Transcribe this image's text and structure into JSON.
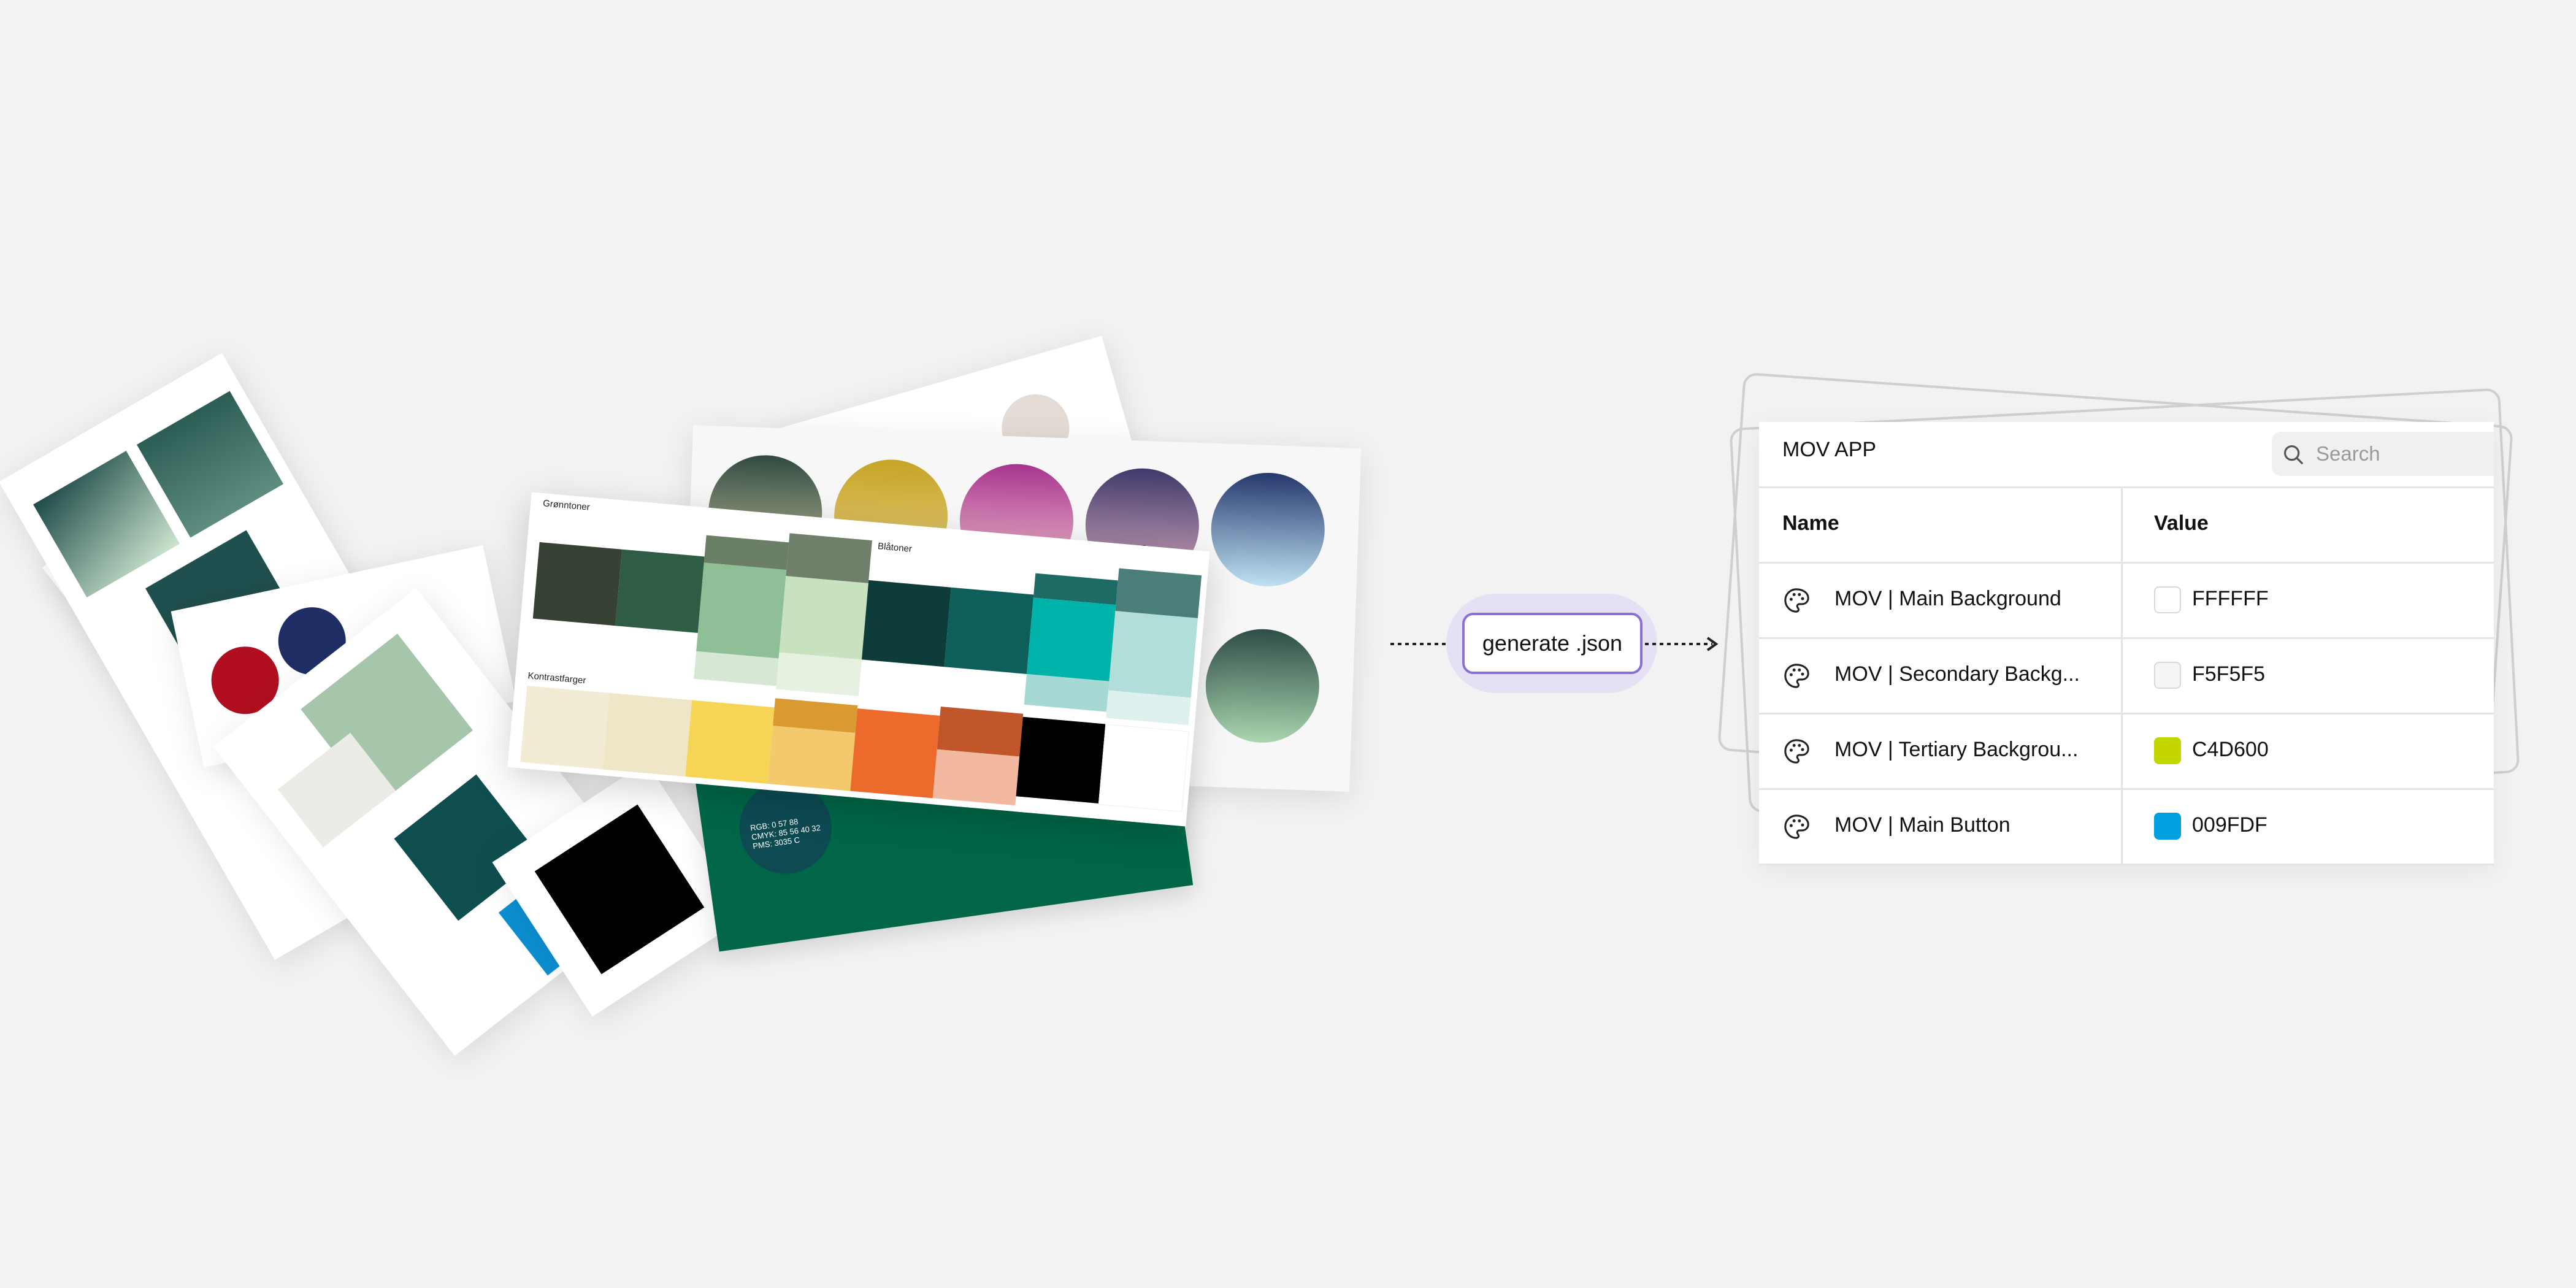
{
  "sheet": {
    "grunntoner_label": "Grønntoner",
    "blatoner_label": "Blåtoner",
    "kontrast_label": "Kontrastfarger",
    "circle_caption": "RGB: 0 57 88\nCMYK: 85 56 40 32\nPMS: 3035 C"
  },
  "action": {
    "label": "generate .json"
  },
  "table": {
    "app_title": "MOV APP",
    "search_placeholder": "Search",
    "headers": {
      "name": "Name",
      "value": "Value"
    },
    "rows": [
      {
        "name": "MOV | Main Background",
        "value": "FFFFFF",
        "color": "#FFFFFF"
      },
      {
        "name": "MOV | Secondary Backg...",
        "value": "F5F5F5",
        "color": "#F5F5F5"
      },
      {
        "name": "MOV | Tertiary Backgrou...",
        "value": "C4D600",
        "color": "#C4D600"
      },
      {
        "name": "MOV | Main Button",
        "value": "009FDF",
        "color": "#009FDF"
      }
    ]
  },
  "colors": {
    "accent_outline": "#8b6fd6",
    "accent_glow": "#e6e0f4",
    "panel_border": "#e4e4e4"
  }
}
